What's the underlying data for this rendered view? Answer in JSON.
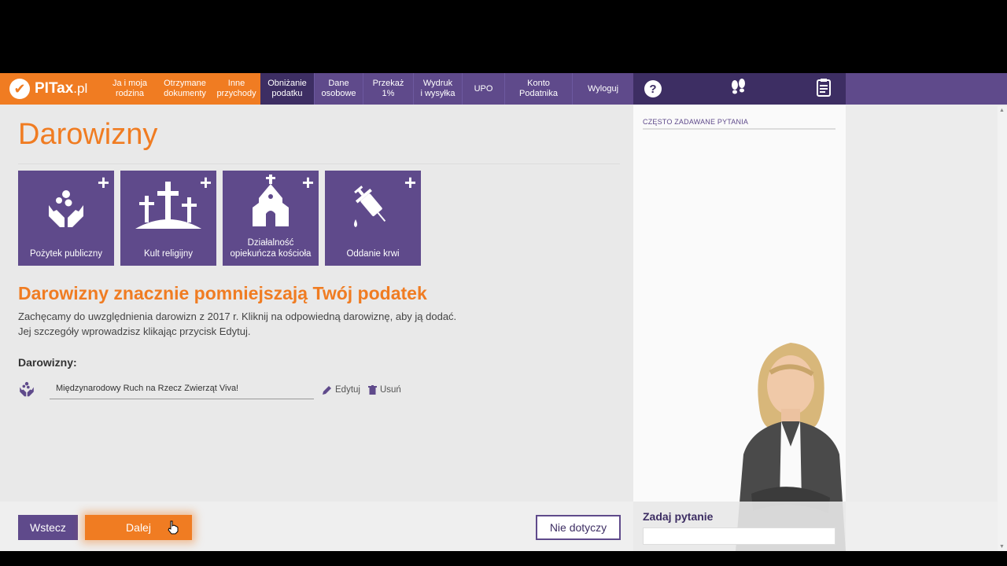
{
  "brand": {
    "name": "PITax",
    "suffix": ".pl"
  },
  "nav": {
    "items": [
      {
        "label_1": "Ja i moja",
        "label_2": "rodzina"
      },
      {
        "label_1": "Otrzymane",
        "label_2": "dokumenty"
      },
      {
        "label_1": "Inne",
        "label_2": "przychody"
      },
      {
        "label_1": "Obniżanie",
        "label_2": "podatku"
      },
      {
        "label_1": "Dane",
        "label_2": "osobowe"
      },
      {
        "label_1": "Przekaż",
        "label_2": "1%"
      },
      {
        "label_1": "Wydruk",
        "label_2": "i wysyłka"
      },
      {
        "label_1": "UPO",
        "label_2": ""
      },
      {
        "label_1": "Konto",
        "label_2": "Podatnika"
      },
      {
        "label_1": "Wyloguj",
        "label_2": ""
      }
    ],
    "help_icon": "?"
  },
  "main": {
    "title": "Darowizny",
    "tiles": [
      {
        "label_1": "Pożytek publiczny",
        "label_2": "",
        "icon": "hands-icon"
      },
      {
        "label_1": "Kult religijny",
        "label_2": "",
        "icon": "crosses-icon"
      },
      {
        "label_1": "Działalność",
        "label_2": "opiekuńcza kościoła",
        "icon": "church-icon"
      },
      {
        "label_1": "Oddanie krwi",
        "label_2": "",
        "icon": "syringe-icon"
      }
    ],
    "plus": "+",
    "subtitle": "Darowizny znacznie pomniejszają Twój podatek",
    "desc_1": "Zachęcamy do uwzględnienia darowizn z 2017 r. Kliknij na odpowiedną darowiznę, aby ją dodać.",
    "desc_2": "Jej szczegóły wprowadzisz klikając przycisk Edytuj.",
    "donations_label": "Darowizny:",
    "donations": [
      {
        "name": "Międzynarodowy Ruch na Rzecz Zwierząt Viva!",
        "edit": "Edytuj",
        "delete": "Usuń"
      }
    ]
  },
  "buttons": {
    "back": "Wstecz",
    "next": "Dalej",
    "not_applicable": "Nie dotyczy"
  },
  "side": {
    "faq_title": "CZĘSTO ZADAWANE PYTANIA",
    "ask_label": "Zadaj pytanie",
    "ask_placeholder": ""
  },
  "colors": {
    "orange": "#f07c22",
    "purple": "#5f4a8b",
    "dark_purple": "#3d2e63"
  }
}
